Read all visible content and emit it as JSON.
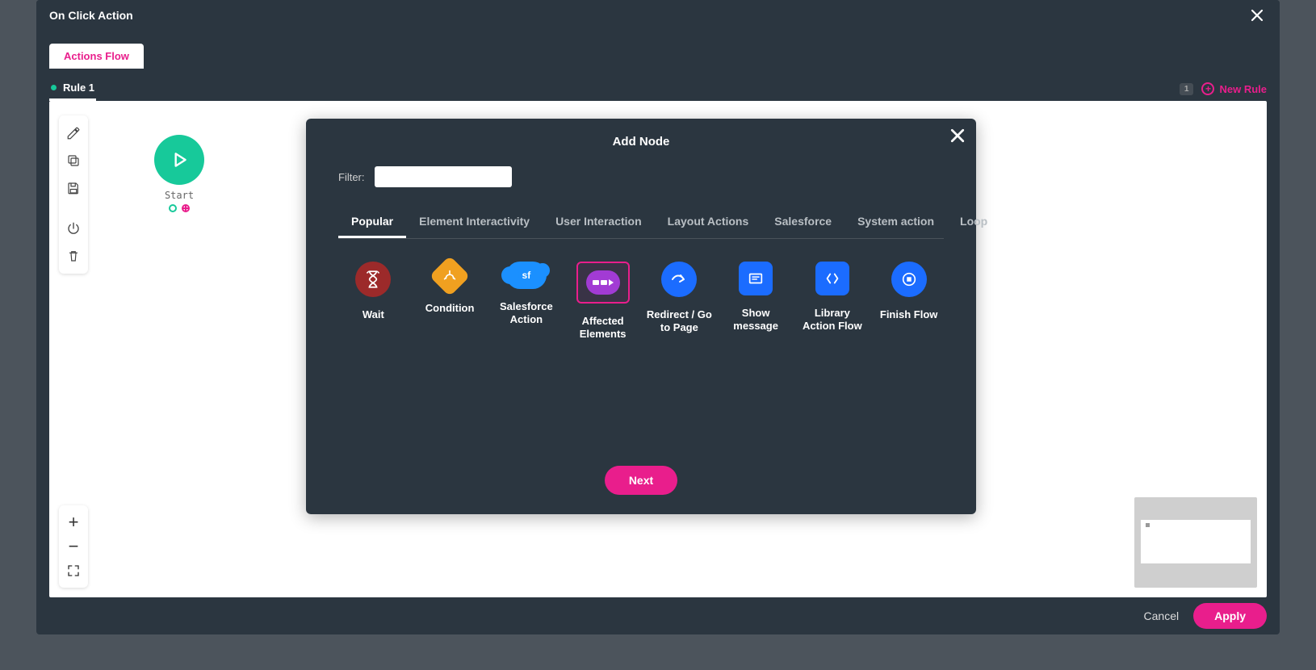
{
  "titleBar": {
    "title": "On Click Action"
  },
  "tabs": {
    "actionsFlow": "Actions Flow"
  },
  "ruleBar": {
    "ruleLabel": "Rule 1",
    "count": "1",
    "newRule": "New Rule"
  },
  "startNode": {
    "label": "Start"
  },
  "modal": {
    "title": "Add Node",
    "filterLabel": "Filter:",
    "tabs": [
      "Popular",
      "Element Interactivity",
      "User Interaction",
      "Layout Actions",
      "Salesforce",
      "System action",
      "Loop"
    ],
    "activeTab": 0,
    "nextLabel": "Next",
    "nodes": [
      {
        "id": "wait",
        "label": "Wait"
      },
      {
        "id": "condition",
        "label": "Condition"
      },
      {
        "id": "salesforce",
        "label": "Salesforce Action"
      },
      {
        "id": "affected",
        "label": "Affected Elements"
      },
      {
        "id": "redirect",
        "label": "Redirect / Go to Page"
      },
      {
        "id": "showmsg",
        "label": "Show message"
      },
      {
        "id": "libflow",
        "label": "Library Action Flow"
      },
      {
        "id": "finish",
        "label": "Finish Flow"
      }
    ]
  },
  "footer": {
    "cancel": "Cancel",
    "apply": "Apply"
  }
}
